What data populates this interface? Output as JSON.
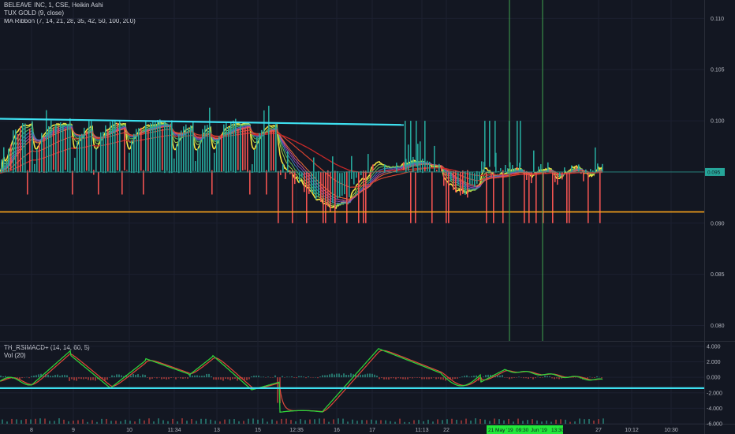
{
  "legend": {
    "title": "BELEAVE INC, 1, CSE, Heikin Ashi",
    "ind1": "TUX GOLD (9, close)",
    "ind2": "MA Ribbon (7, 14, 21, 28, 35, 42, 50, 100, 200)",
    "osc1": "TH_RSIMACD+ (14, 14, 60, 5)",
    "osc2": "Vol (20)"
  },
  "colors": {
    "background": "#131722",
    "grid": "#1c2030",
    "bull": "#26a69a",
    "bear": "#ef5350",
    "cyan": "#3ee0f0",
    "orange": "#f7a21b",
    "yellow": "#f0e442",
    "red_ma": "#c62828",
    "green_line": "#2fcf3a",
    "vline": "#3fa34d",
    "price_tag_bg": "#26a69a"
  },
  "chart_data": [
    {
      "type": "candlestick",
      "title": "BELEAVE INC, 1, CSE, Heikin Ashi",
      "y_ticks": [
        "0.110",
        "0.105",
        "0.100",
        "0.095",
        "0.090",
        "0.085",
        "0.080"
      ],
      "ylim": [
        0.0785,
        0.1118
      ],
      "x_ticks": [
        "8",
        "9",
        "10",
        "11:34",
        "13",
        "15",
        "12:35",
        "16",
        "17",
        "11:13",
        "22",
        "27",
        "10:12",
        "10:30"
      ],
      "last_price": "0.095",
      "highlighted_dates": [
        "21 May '19",
        "09:30",
        "Jun '19",
        "13:30"
      ],
      "levels": [
        {
          "name": "cyan-trendline",
          "from": 0.1002,
          "to": 0.0996
        },
        {
          "name": "orange-support",
          "value": 0.0911
        }
      ]
    },
    {
      "type": "line",
      "title": "TH_RSIMACD+ (14, 14, 60, 5)",
      "y_ticks": [
        "4.000",
        "2.000",
        "0.000",
        "-2.000",
        "-4.000",
        "-6.000"
      ],
      "ylim": [
        -6.0,
        4.6
      ],
      "level": -1.4
    }
  ]
}
